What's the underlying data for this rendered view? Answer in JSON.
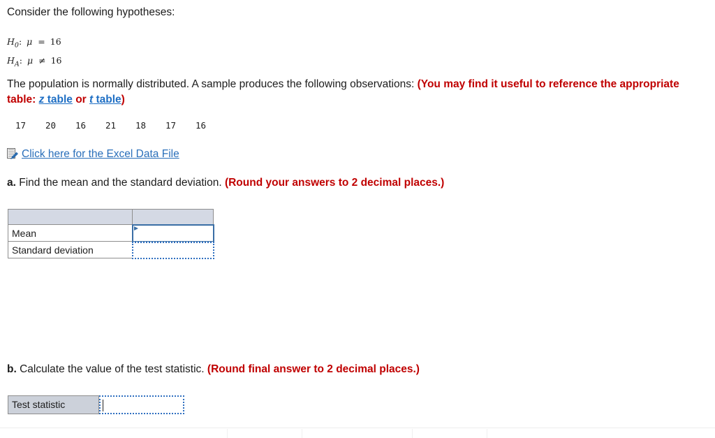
{
  "intro": {
    "text": "Consider the following hypotheses:"
  },
  "hypotheses": [
    {
      "symbol": "H",
      "subscript": "0",
      "colon": ":",
      "parameter": "μ",
      "operator": "=",
      "value": "16"
    },
    {
      "symbol": "H",
      "subscript": "A",
      "colon": ":",
      "parameter": "μ",
      "operator": "≠",
      "value": "16"
    }
  ],
  "paragraph": {
    "lead": "The population is normally distributed. A sample produces the following observations: ",
    "note_open": "(You may find it useful to reference the appropriate table: ",
    "link_z_letter": "z",
    "link_z_word": " table",
    "note_or": " or ",
    "link_t_letter": "t",
    "link_t_word": " table",
    "note_close": ")"
  },
  "observations": {
    "values": [
      "17",
      "20",
      "16",
      "21",
      "18",
      "17",
      "16"
    ]
  },
  "excel": {
    "icon": "excel-file-icon",
    "link_text": "Click here for the Excel Data File"
  },
  "part_a": {
    "label": "a.",
    "question": " Find the mean and the standard deviation. ",
    "round_note": "(Round your answers to 2 decimal places.)",
    "table": {
      "header": [
        "",
        ""
      ],
      "rows": [
        {
          "label": "Mean",
          "value": ""
        },
        {
          "label": "Standard deviation",
          "value": ""
        }
      ]
    }
  },
  "part_b": {
    "label": "b.",
    "question": " Calculate the value of the test statistic. ",
    "round_note": "(Round final answer to 2 decimal places.)",
    "field": {
      "label": "Test statistic",
      "value": ""
    }
  },
  "colors": {
    "red_note": "#c00000",
    "link_blue": "#2a6fba",
    "header_fill": "#d4d9e4",
    "label_fill": "#ccd1da",
    "active_border": "#3a6ea5",
    "dotted_border": "#2f6fc0"
  }
}
